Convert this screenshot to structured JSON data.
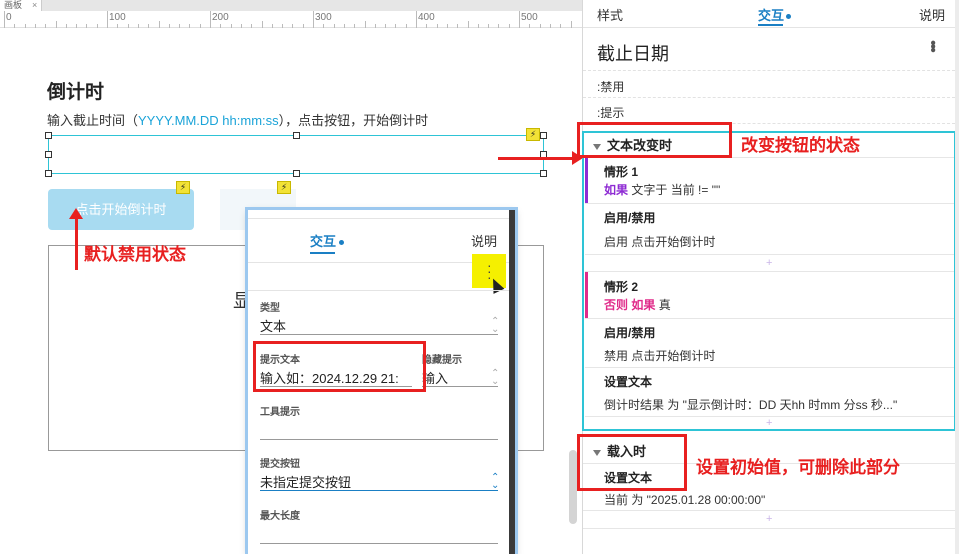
{
  "canvas": {
    "tab_label": "画板",
    "tab_close": "×",
    "ruler": {
      "labels": [
        "0",
        "100",
        "200",
        "300",
        "400",
        "500"
      ]
    },
    "title": "倒计时",
    "desc_prefix": "输入截止时间（",
    "desc_format": "YYYY.MM.DD hh:mm:ss",
    "desc_suffix": "），点击按钮，开始倒计时",
    "start_button": "点击开始倒计时",
    "result_partial": "显",
    "annotation_default": "默认禁用状态"
  },
  "popup": {
    "tab_interaction": "交互",
    "tab_notes": "说明",
    "fields": {
      "type_label": "类型",
      "type_value": "文本",
      "hint_label": "提示文本",
      "hint_value": "输入如：2024.12.29 21:",
      "hide_hint_label": "隐藏提示",
      "hide_hint_value": "输入",
      "tooltip_label": "工具提示",
      "tooltip_value": "",
      "submit_label": "提交按钮",
      "submit_value": "未指定提交按钮",
      "maxlen_label": "最大长度",
      "maxlen_value": ""
    }
  },
  "panel": {
    "tabs": {
      "style": "样式",
      "interaction": "交互",
      "notes": "说明"
    },
    "title": "截止日期",
    "more": "⋮",
    "row_disabled": ":禁用",
    "row_hint": ":提示",
    "event1": {
      "name": "文本改变时",
      "case1": {
        "title": "情形 1",
        "if_kw": "如果",
        "condition": "文字于 当前 != \"\"",
        "action_title": "启用/禁用",
        "action_detail": "启用 点击开始倒计时"
      },
      "case2": {
        "title": "情形 2",
        "else_kw": "否则 如果",
        "condition": "真",
        "action1_title": "启用/禁用",
        "action1_detail": "禁用 点击开始倒计时",
        "action2_title": "设置文本",
        "action2_detail": "倒计时结果 为 \"显示倒计时：DD 天hh 时mm 分ss 秒...\""
      },
      "annotation": "改变按钮的状态"
    },
    "event2": {
      "name": "载入时",
      "action_title": "设置文本",
      "action_detail": "当前 为 \"2025.01.28 00:00:00\"",
      "annotation": "设置初始值，可删除此部分"
    },
    "plus": "+"
  },
  "colors": {
    "accent": "#1a7fc4",
    "teal_frame": "#2ec4d6",
    "annotation_red": "#e82020",
    "button_disabled": "#a8dbf1",
    "case1_bar": "#8e2bd3",
    "case2_bar": "#e02b8a"
  }
}
